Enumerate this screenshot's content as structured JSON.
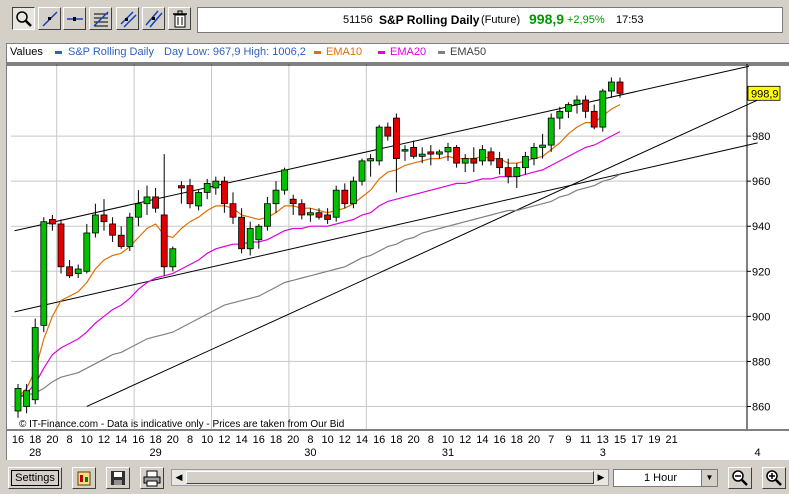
{
  "toolbar": {
    "tools": [
      {
        "icon": "zoom-tool-icon",
        "active": true
      },
      {
        "icon": "draw-line-icon",
        "active": false
      },
      {
        "icon": "horizontal-line-icon",
        "active": false
      },
      {
        "icon": "fibonacci-icon",
        "active": false
      },
      {
        "icon": "channel-tool-icon",
        "active": false
      },
      {
        "icon": "parallel-lines-icon",
        "active": false
      },
      {
        "icon": "trash-icon",
        "active": false
      }
    ]
  },
  "quote": {
    "code": "51156",
    "name": "S&P Rolling Daily",
    "type": "(Future)",
    "price": "998,9",
    "change": "+2,95%",
    "time": "17:53",
    "color": "#009a00"
  },
  "legend": {
    "values_label": "Values",
    "series_label": "S&P Rolling Daily",
    "day_range": "Day Low: 967,9 High: 1006,2",
    "ema10": "EMA10",
    "ema20": "EMA20",
    "ema50": "EMA50"
  },
  "watermark": "© IT-Finance.com - Data is indicative only - Prices are taken from Our Bid",
  "statusbar": {
    "settings_label": "Settings",
    "timeframe": "1 Hour"
  },
  "chart_data": {
    "type": "candlestick",
    "ylim": [
      850,
      1012
    ],
    "yticks": [
      860,
      880,
      900,
      920,
      940,
      960,
      980
    ],
    "y_ticklabels": [
      "860",
      "880",
      "900",
      "920",
      "940",
      "960",
      "980"
    ],
    "last_price_label": "998,9",
    "x_ticklabels": [
      "16",
      "18",
      "20",
      "8",
      "10",
      "12",
      "14",
      "16",
      "18",
      "20",
      "8",
      "10",
      "12",
      "14",
      "16",
      "18",
      "20",
      "8",
      "10",
      "12",
      "14",
      "16",
      "18",
      "20",
      "8",
      "10",
      "12",
      "14",
      "16",
      "18",
      "20",
      "7",
      "9",
      "11",
      "13",
      "15",
      "17",
      "19",
      "21"
    ],
    "date_labels": [
      {
        "label": "28",
        "at": 1
      },
      {
        "label": "29",
        "at": 8
      },
      {
        "label": "30",
        "at": 17
      },
      {
        "label": "31",
        "at": 25
      },
      {
        "label": "3",
        "at": 34
      },
      {
        "label": "4",
        "at": 43
      }
    ],
    "day_separators": [
      4.5,
      13.5,
      22.5,
      31.5,
      40.5
    ],
    "candles": [
      {
        "o": 858,
        "h": 870,
        "l": 855,
        "c": 868
      },
      {
        "o": 860,
        "h": 870,
        "l": 857,
        "c": 867
      },
      {
        "o": 863,
        "h": 899,
        "l": 861,
        "c": 895
      },
      {
        "o": 896,
        "h": 944,
        "l": 893,
        "c": 942
      },
      {
        "o": 943,
        "h": 945,
        "l": 938,
        "c": 941
      },
      {
        "o": 941,
        "h": 943,
        "l": 919,
        "c": 922
      },
      {
        "o": 922,
        "h": 925,
        "l": 917,
        "c": 918
      },
      {
        "o": 919,
        "h": 923,
        "l": 917,
        "c": 921
      },
      {
        "o": 920,
        "h": 941,
        "l": 919,
        "c": 937
      },
      {
        "o": 937,
        "h": 950,
        "l": 935,
        "c": 945
      },
      {
        "o": 945,
        "h": 952,
        "l": 938,
        "c": 942
      },
      {
        "o": 941,
        "h": 944,
        "l": 933,
        "c": 936
      },
      {
        "o": 936,
        "h": 940,
        "l": 930,
        "c": 931
      },
      {
        "o": 931,
        "h": 946,
        "l": 929,
        "c": 944
      },
      {
        "o": 944,
        "h": 956,
        "l": 940,
        "c": 950
      },
      {
        "o": 950,
        "h": 958,
        "l": 945,
        "c": 953
      },
      {
        "o": 953,
        "h": 957,
        "l": 946,
        "c": 948
      },
      {
        "o": 945,
        "h": 972,
        "l": 918,
        "c": 922
      },
      {
        "o": 922,
        "h": 931,
        "l": 920,
        "c": 930
      },
      {
        "o": 958,
        "h": 960,
        "l": 950,
        "c": 957
      },
      {
        "o": 958,
        "h": 961,
        "l": 948,
        "c": 950
      },
      {
        "o": 949,
        "h": 956,
        "l": 947,
        "c": 955
      },
      {
        "o": 955,
        "h": 961,
        "l": 952,
        "c": 959
      },
      {
        "o": 957,
        "h": 962,
        "l": 954,
        "c": 960
      },
      {
        "o": 960,
        "h": 962,
        "l": 946,
        "c": 950
      },
      {
        "o": 950,
        "h": 955,
        "l": 941,
        "c": 944
      },
      {
        "o": 944,
        "h": 948,
        "l": 928,
        "c": 930
      },
      {
        "o": 930,
        "h": 942,
        "l": 927,
        "c": 939
      },
      {
        "o": 934,
        "h": 941,
        "l": 930,
        "c": 940
      },
      {
        "o": 940,
        "h": 953,
        "l": 938,
        "c": 950
      },
      {
        "o": 950,
        "h": 960,
        "l": 946,
        "c": 956
      },
      {
        "o": 956,
        "h": 966,
        "l": 954,
        "c": 965
      },
      {
        "o": 952,
        "h": 954,
        "l": 945,
        "c": 950
      },
      {
        "o": 950,
        "h": 952,
        "l": 943,
        "c": 945
      },
      {
        "o": 945,
        "h": 948,
        "l": 942,
        "c": 946
      },
      {
        "o": 946,
        "h": 948,
        "l": 943,
        "c": 944
      },
      {
        "o": 945,
        "h": 948,
        "l": 941,
        "c": 943
      },
      {
        "o": 944,
        "h": 958,
        "l": 942,
        "c": 956
      },
      {
        "o": 956,
        "h": 959,
        "l": 948,
        "c": 950
      },
      {
        "o": 950,
        "h": 962,
        "l": 948,
        "c": 960
      },
      {
        "o": 960,
        "h": 970,
        "l": 958,
        "c": 969
      },
      {
        "o": 969,
        "h": 972,
        "l": 962,
        "c": 970
      },
      {
        "o": 969,
        "h": 985,
        "l": 967,
        "c": 984
      },
      {
        "o": 984,
        "h": 986,
        "l": 978,
        "c": 980
      },
      {
        "o": 988,
        "h": 990,
        "l": 955,
        "c": 970
      },
      {
        "o": 974,
        "h": 976,
        "l": 969,
        "c": 974
      },
      {
        "o": 975,
        "h": 978,
        "l": 970,
        "c": 971
      },
      {
        "o": 971,
        "h": 975,
        "l": 968,
        "c": 972
      },
      {
        "o": 973,
        "h": 976,
        "l": 967,
        "c": 972
      },
      {
        "o": 972,
        "h": 974,
        "l": 970,
        "c": 973
      },
      {
        "o": 973,
        "h": 977,
        "l": 969,
        "c": 975
      },
      {
        "o": 975,
        "h": 976,
        "l": 966,
        "c": 968
      },
      {
        "o": 968,
        "h": 972,
        "l": 964,
        "c": 970
      },
      {
        "o": 970,
        "h": 975,
        "l": 964,
        "c": 968
      },
      {
        "o": 969,
        "h": 976,
        "l": 967,
        "c": 974
      },
      {
        "o": 973,
        "h": 975,
        "l": 967,
        "c": 969
      },
      {
        "o": 970,
        "h": 973,
        "l": 963,
        "c": 966
      },
      {
        "o": 966,
        "h": 970,
        "l": 959,
        "c": 962
      },
      {
        "o": 962,
        "h": 968,
        "l": 957,
        "c": 966
      },
      {
        "o": 966,
        "h": 973,
        "l": 963,
        "c": 971
      },
      {
        "o": 970,
        "h": 977,
        "l": 967,
        "c": 975
      },
      {
        "o": 975,
        "h": 981,
        "l": 970,
        "c": 976
      },
      {
        "o": 976,
        "h": 990,
        "l": 973,
        "c": 988
      },
      {
        "o": 988,
        "h": 993,
        "l": 983,
        "c": 991
      },
      {
        "o": 991,
        "h": 995,
        "l": 988,
        "c": 994
      },
      {
        "o": 994,
        "h": 998,
        "l": 990,
        "c": 996
      },
      {
        "o": 996,
        "h": 998,
        "l": 988,
        "c": 991
      },
      {
        "o": 991,
        "h": 994,
        "l": 983,
        "c": 984
      },
      {
        "o": 984,
        "h": 1001,
        "l": 982,
        "c": 1000
      },
      {
        "o": 1000,
        "h": 1006,
        "l": 997,
        "c": 1004
      },
      {
        "o": 1004,
        "h": 1006,
        "l": 997,
        "c": 999
      }
    ],
    "ema10": [
      864,
      868,
      876,
      890,
      900,
      907,
      909,
      911,
      915,
      921,
      925,
      927,
      928,
      931,
      935,
      939,
      941,
      936,
      935,
      939,
      942,
      944,
      947,
      949,
      949,
      948,
      945,
      944,
      943,
      944,
      946,
      949,
      949,
      948,
      948,
      947,
      946,
      947,
      948,
      950,
      953,
      956,
      961,
      964,
      965,
      967,
      968,
      969,
      970,
      970,
      971,
      970,
      970,
      970,
      971,
      970,
      970,
      968,
      968,
      969,
      970,
      971,
      974,
      977,
      981,
      984,
      986,
      986,
      989,
      992,
      994
    ],
    "ema20": [
      864,
      866,
      870,
      877,
      883,
      886,
      888,
      890,
      893,
      897,
      900,
      903,
      905,
      908,
      912,
      915,
      917,
      918,
      919,
      921,
      923,
      925,
      928,
      930,
      931,
      932,
      932,
      933,
      933,
      934,
      936,
      938,
      939,
      939,
      940,
      940,
      940,
      941,
      942,
      943,
      945,
      946,
      949,
      951,
      952,
      953,
      954,
      955,
      956,
      957,
      958,
      959,
      959,
      960,
      961,
      961,
      962,
      962,
      962,
      963,
      964,
      965,
      967,
      969,
      971,
      973,
      975,
      976,
      978,
      980,
      982
    ],
    "ema50": [
      864,
      865,
      866,
      868,
      871,
      873,
      874,
      875,
      877,
      879,
      881,
      883,
      884,
      886,
      888,
      890,
      891,
      892,
      893,
      895,
      897,
      899,
      901,
      903,
      905,
      906,
      907,
      908,
      909,
      911,
      913,
      915,
      916,
      917,
      918,
      919,
      920,
      921,
      922,
      924,
      926,
      927,
      929,
      931,
      932,
      934,
      935,
      937,
      938,
      939,
      940,
      941,
      942,
      943,
      944,
      945,
      946,
      947,
      947,
      948,
      949,
      950,
      951,
      953,
      954,
      956,
      957,
      958,
      960,
      961,
      963
    ]
  },
  "colors": {
    "up": "#00c000",
    "down": "#e00000",
    "ema10": "#e07000",
    "ema20": "#e000e0",
    "ema50": "#808080",
    "series": "#3060c0",
    "price_label_bg": "#ffff00"
  }
}
